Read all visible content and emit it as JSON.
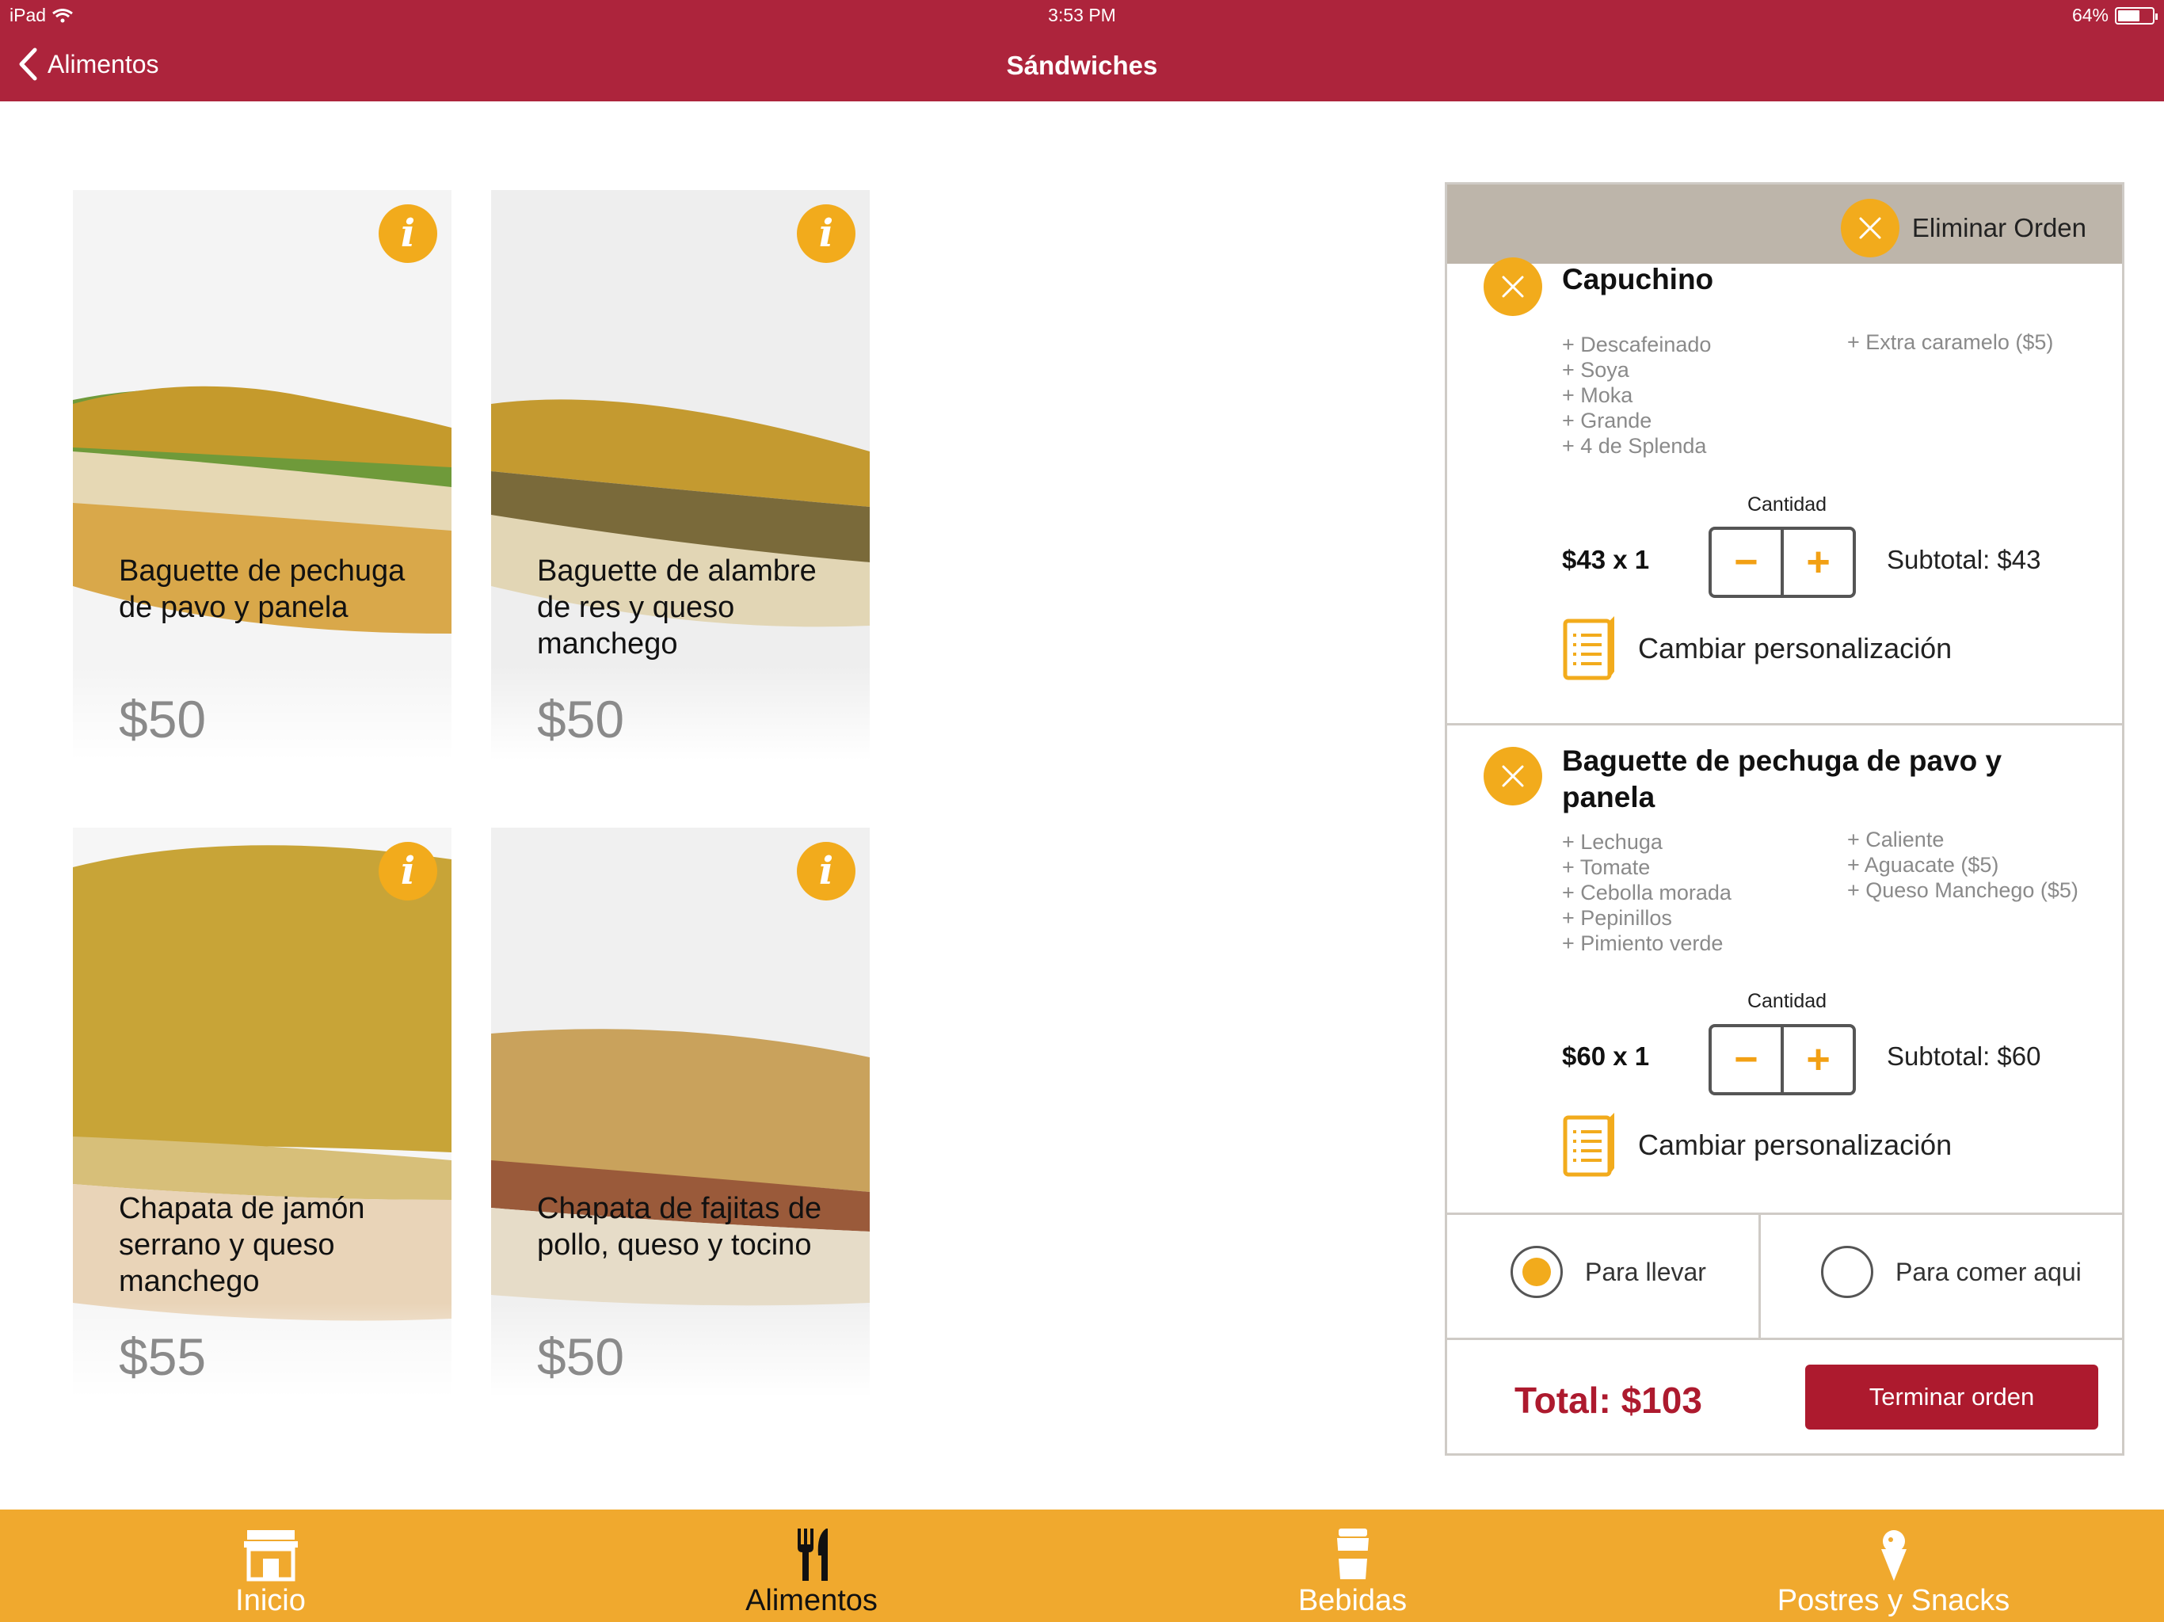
{
  "status": {
    "device": "iPad",
    "time": "3:53 PM",
    "battery": "64%",
    "battery_level": 0.64
  },
  "nav": {
    "back_label": "Alimentos",
    "title": "Sándwiches"
  },
  "products": [
    {
      "name": "Baguette de pechuga de pavo y panela",
      "price": "$50"
    },
    {
      "name": "Baguette de alambre de res y queso manchego",
      "price": "$50"
    },
    {
      "name": "Chapata de jamón serrano y queso manchego",
      "price": "$55"
    },
    {
      "name": "Chapata de fajitas de pollo, queso y tocino",
      "price": "$50"
    }
  ],
  "order": {
    "clear_label": "Eliminar Orden",
    "quantity_label": "Cantidad",
    "customize_label": "Cambiar personalización",
    "items": [
      {
        "title": "Capuchino",
        "mods_left": [
          "+ Descafeinado",
          "+ Soya",
          "+ Moka",
          "+ Grande",
          "+ 4 de Splenda"
        ],
        "mods_right": [
          "+ Extra caramelo ($5)"
        ],
        "unit": "$43 x 1",
        "subtotal": "Subtotal: $43"
      },
      {
        "title": "Baguette de pechuga de pavo y panela",
        "mods_left": [
          "+ Lechuga",
          "+ Tomate",
          "+ Cebolla morada",
          "+ Pepinillos",
          "+ Pimiento verde"
        ],
        "mods_right": [
          "+ Caliente",
          "+ Aguacate ($5)",
          "+ Queso Manchego ($5)"
        ],
        "unit": "$60 x 1",
        "subtotal": "Subtotal: $60"
      }
    ],
    "order_type": {
      "options": [
        "Para llevar",
        "Para comer aqui"
      ],
      "selected": "Para llevar"
    },
    "total": "Total: $103",
    "finish_label": "Terminar orden"
  },
  "tabs": [
    {
      "label": "Inicio",
      "icon": "store-icon"
    },
    {
      "label": "Alimentos",
      "icon": "fork-knife-icon",
      "active": true
    },
    {
      "label": "Bebidas",
      "icon": "cup-icon"
    },
    {
      "label": "Postres y Snacks",
      "icon": "ice-cream-icon"
    }
  ],
  "colors": {
    "brand_red": "#ad243c",
    "accent_orange": "#f2ab1c",
    "tabbar": "#f0a92e"
  }
}
